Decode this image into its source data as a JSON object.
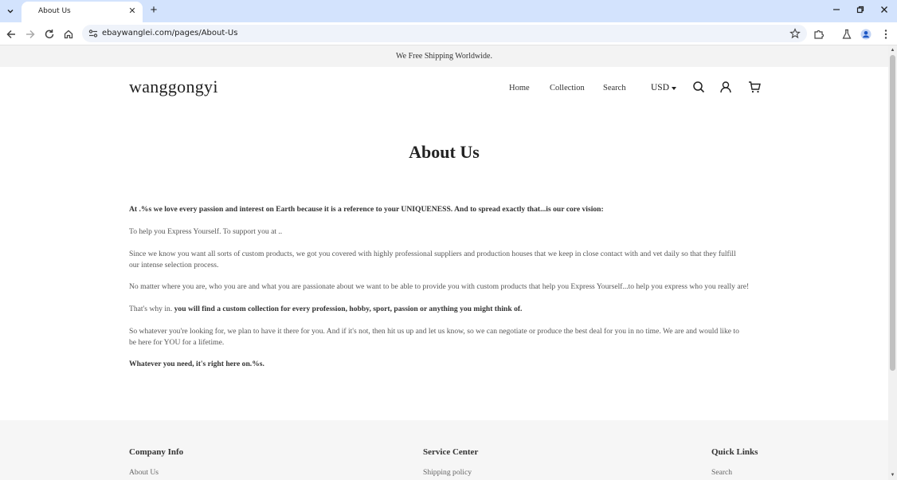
{
  "browser": {
    "tab_title": "About Us",
    "url": "ebaywanglei.com/pages/About-Us"
  },
  "announcement": "We Free Shipping Worldwide.",
  "header": {
    "logo": "wanggongyi",
    "nav": {
      "home": "Home",
      "collection": "Collection",
      "search": "Search"
    },
    "currency": "USD"
  },
  "page_title": "About Us",
  "content": {
    "p1": "At .%s we love every passion and interest on Earth because it is a reference to your UNIQUENESS. And to spread exactly that...is our core vision:",
    "p2": "To help you Express Yourself. To support you at ..",
    "p3a": "Since we know you want all sorts of custom products, we got you covered with highly professional suppliers and production houses that we keep in close contact with and vet daily so that they fulfill",
    "p3b": "our intense selection process.",
    "p4": "No matter where you are, who you are and what you are passionate about we want to be able to provide you with custom products that help you Express Yourself...to help you express who you really are!",
    "p5_plain": "That's why in. ",
    "p5_bold": "you will find a custom collection for every profession, hobby, sport, passion or anything you might think of.",
    "p6a": "So whatever you're looking for, we plan to have it there for you. And if it's not, then hit us up and let us know, so we can negotiate or produce the best deal for you in no time. We are and would like to",
    "p6b": "be here for YOU for a lifetime.",
    "p7": "Whatever you need, it's right here on.%s."
  },
  "footer": {
    "company_info": {
      "heading": "Company Info",
      "link": "About Us"
    },
    "service_center": {
      "heading": "Service Center",
      "link": "Shipping policy"
    },
    "quick_links": {
      "heading": "Quick Links",
      "link": "Search"
    }
  }
}
